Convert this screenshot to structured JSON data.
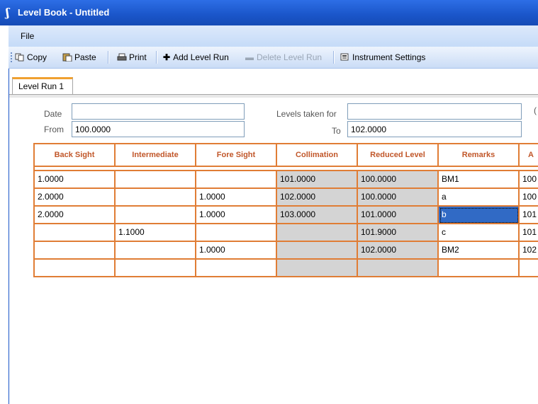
{
  "window": {
    "title": "Level Book - Untitled"
  },
  "menu": {
    "file": "File"
  },
  "toolbar": {
    "copy": "Copy",
    "paste": "Paste",
    "print": "Print",
    "add_level_run": "Add Level Run",
    "delete_level_run": "Delete Level Run",
    "instrument_settings": "Instrument Settings"
  },
  "tabs": [
    {
      "label": "Level Run 1"
    }
  ],
  "form": {
    "date_label": "Date",
    "date_value": "",
    "from_label": "From",
    "from_value": "100.0000",
    "levels_taken_for_label": "Levels taken for",
    "levels_taken_for_value": "",
    "to_label": "To",
    "to_value": "102.0000",
    "cutoff_label": "("
  },
  "grid": {
    "headers": [
      "Back Sight",
      "Intermediate",
      "Fore Sight",
      "Collimation",
      "Reduced Level",
      "Remarks",
      "A"
    ],
    "rows": [
      [
        "1.0000",
        "",
        "",
        "101.0000",
        "100.0000",
        "BM1",
        "100"
      ],
      [
        "2.0000",
        "",
        "1.0000",
        "102.0000",
        "100.0000",
        "a",
        "100"
      ],
      [
        "2.0000",
        "",
        "1.0000",
        "103.0000",
        "101.0000",
        "b",
        "101"
      ],
      [
        "",
        "1.1000",
        "",
        "",
        "101.9000",
        "c",
        "101"
      ],
      [
        "",
        "",
        "1.0000",
        "",
        "102.0000",
        "BM2",
        "102"
      ],
      [
        "",
        "",
        "",
        "",
        "",
        "",
        ""
      ]
    ],
    "selected_cell": {
      "row": 2,
      "col": 5
    }
  },
  "colors": {
    "title_bar": "#1a55c9",
    "grid_lines": "#e07d35",
    "header_text": "#c1572a",
    "computed_cell": "#d4d4d4",
    "selection": "#316ac5"
  }
}
